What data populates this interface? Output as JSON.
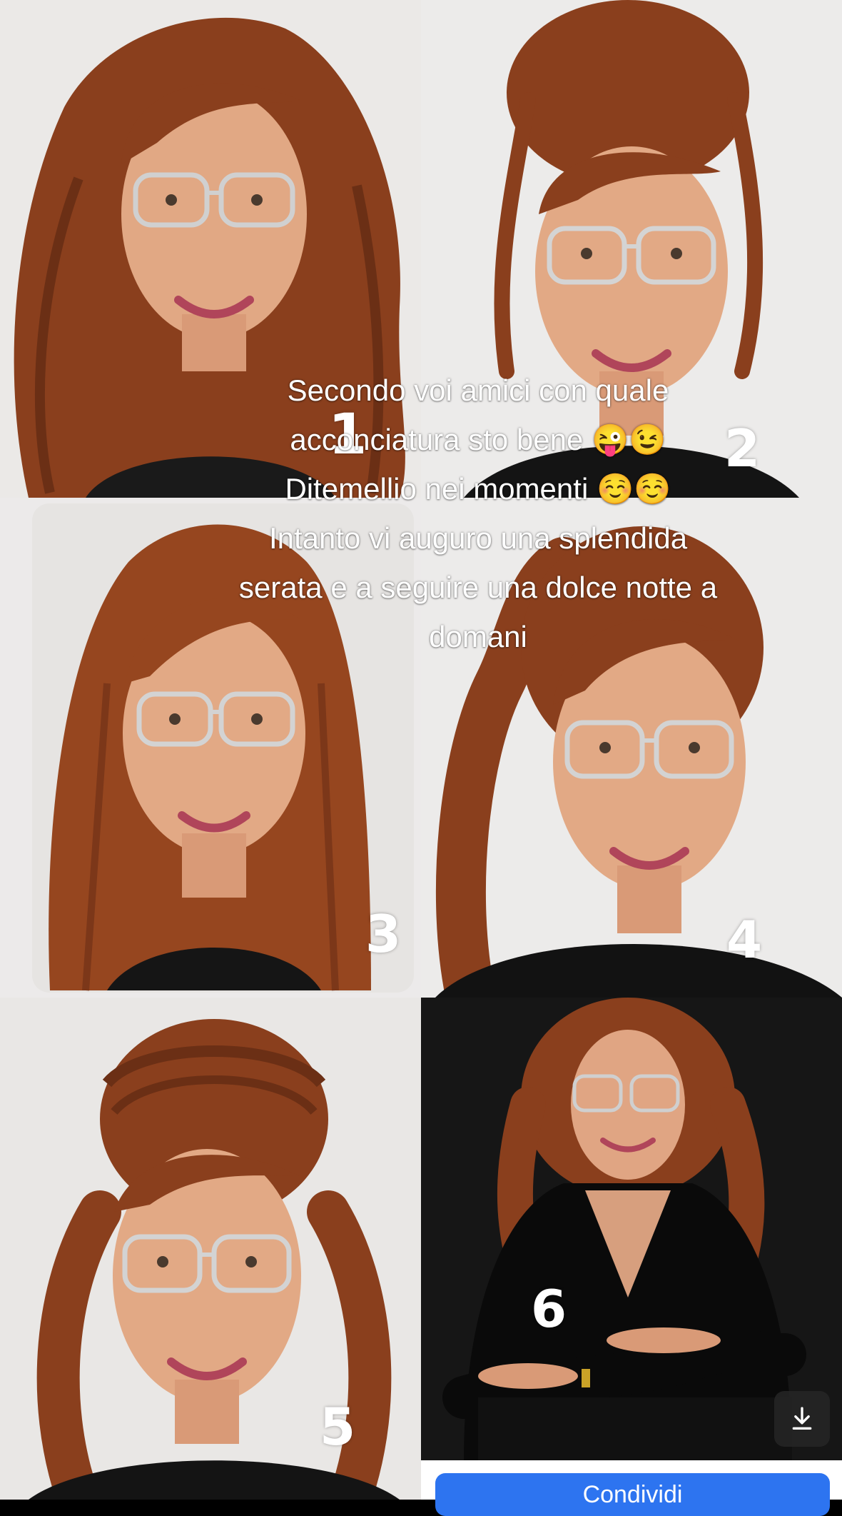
{
  "caption": {
    "text": "Secondo voi amici con quale acconciatura sto bene 😜😉 Ditemellio nei momenti ☺️☺️ Intanto vi auguro una splendida serata e a seguire una dolce notte a domani"
  },
  "photos": [
    {
      "number": "1",
      "hairstyle": "long curly"
    },
    {
      "number": "2",
      "hairstyle": "curly updo"
    },
    {
      "number": "3",
      "hairstyle": "long straight"
    },
    {
      "number": "4",
      "hairstyle": "high ponytail"
    },
    {
      "number": "5",
      "hairstyle": "braided half-up waves"
    },
    {
      "number": "6",
      "hairstyle": "curly, dark background"
    }
  ],
  "controls": {
    "download_icon": "download-icon",
    "action_button_label": "Condividi"
  },
  "colors": {
    "hair": "#8a3f1d",
    "background_light": "#ececec",
    "background_dark": "#141414",
    "action_button": "#2d74f0"
  }
}
